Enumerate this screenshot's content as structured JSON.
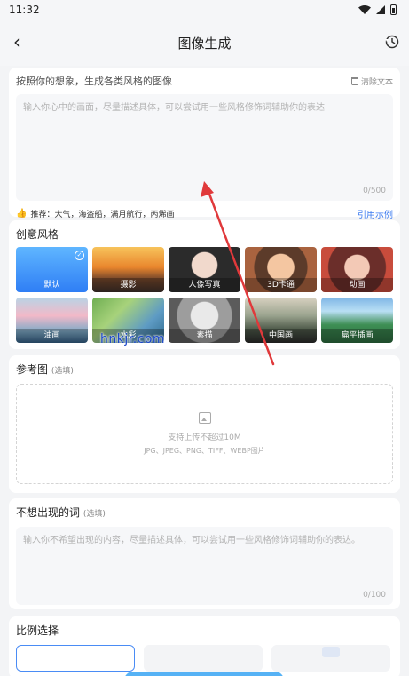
{
  "status_bar": {
    "time": "11:32"
  },
  "header": {
    "title": "图像生成"
  },
  "prompt": {
    "title": "按照你的想象，生成各类风格的图像",
    "clear_label": "清除文本",
    "placeholder": "输入你心中的画面，尽量描述具体，可以尝试用一些风格修饰词辅助你的表达",
    "counter": "0/500",
    "recommend_text": "推荐：大气，海盗船，满月航行，丙烯画",
    "example_link": "引用示例"
  },
  "styles": {
    "title": "创意风格",
    "items": [
      {
        "label": "默认",
        "selected": true
      },
      {
        "label": "摄影"
      },
      {
        "label": "人像写真"
      },
      {
        "label": "3D卡通"
      },
      {
        "label": "动画"
      },
      {
        "label": "油画"
      },
      {
        "label": "水彩"
      },
      {
        "label": "素描"
      },
      {
        "label": "中国画"
      },
      {
        "label": "扁平插画"
      }
    ]
  },
  "watermark": "hnkjr.com",
  "reference": {
    "title": "参考图",
    "optional": "(选填)",
    "upload_text": "支持上传不超过10M",
    "formats": "JPG、JPEG、PNG、TIFF、WEBP图片"
  },
  "negative": {
    "title": "不想出现的词",
    "optional": "(选填)",
    "placeholder": "输入你不希望出现的内容，尽量描述具体，可以尝试用一些风格修饰词辅助你的表达。",
    "counter": "0/100"
  },
  "ratio": {
    "title": "比例选择"
  },
  "colors": {
    "accent": "#3d7cf0",
    "annotation_arrow": "#e0393b"
  }
}
